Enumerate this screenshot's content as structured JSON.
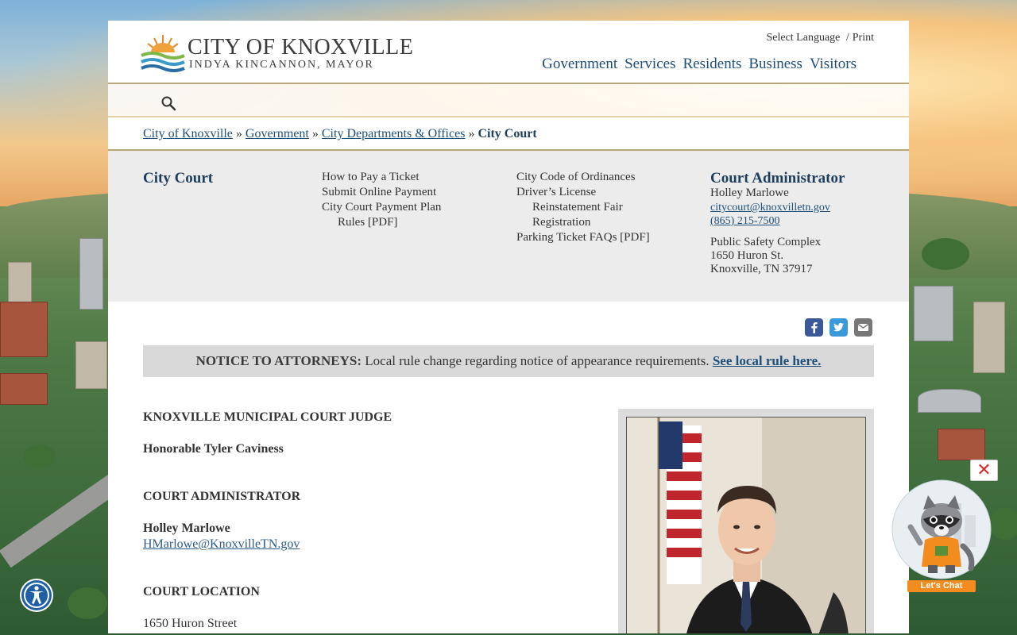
{
  "header": {
    "logo_title": "CITY OF KNOXVILLE",
    "logo_subtitle": "INDYA KINCANNON, MAYOR",
    "select_language": "Select Language",
    "util_sep": "/",
    "print": "Print",
    "nav": [
      "Government",
      "Services",
      "Residents",
      "Business",
      "Visitors"
    ]
  },
  "breadcrumb": {
    "items": [
      "City of Knoxville",
      "Government",
      "City Departments & Offices"
    ],
    "separator": "»",
    "current": "City Court"
  },
  "dept": {
    "title": "City Court",
    "links_col2": [
      "How to Pay a Ticket",
      "Submit Online Payment",
      "City Court Payment Plan",
      "Rules [PDF]"
    ],
    "links_col3": [
      "City Code of Ordinances",
      "Driver’s License",
      "Reinstatement Fair",
      "Registration",
      "Parking Ticket FAQs [PDF]"
    ],
    "admin_title": "Court Administrator",
    "admin_name": "Holley Marlowe",
    "admin_email": "citycourt@knoxvilletn.gov",
    "admin_phone": "(865) 215-7500",
    "address": [
      "Public Safety Complex",
      "1650 Huron St.",
      "Knoxville, TN 37917"
    ]
  },
  "notice": {
    "label": "NOTICE TO ATTORNEYS:",
    "text": " Local rule change regarding notice of appearance requirements. ",
    "link": "See local rule here."
  },
  "body": {
    "judge_heading": "KNOXVILLE MUNICIPAL COURT JUDGE",
    "judge_name": "Honorable Tyler Caviness",
    "admin_heading": "COURT ADMINISTRATOR",
    "admin_name": "Holley Marlowe",
    "admin_email": "HMarlowe@KnoxvilleTN.gov",
    "location_heading": "COURT LOCATION",
    "location_line1": "1650 Huron Street"
  },
  "chat": {
    "close": "✕",
    "label": "Let's Chat"
  },
  "colors": {
    "link": "#1d4f7a",
    "accent_gold": "#b9a67a",
    "panel_grey": "#ececec",
    "notice_grey": "#d9d9d9",
    "chat_orange": "#f28c1e"
  },
  "icons": [
    "search-icon",
    "facebook-icon",
    "twitter-icon",
    "email-icon",
    "accessibility-icon",
    "chatbot-avatar-icon"
  ]
}
